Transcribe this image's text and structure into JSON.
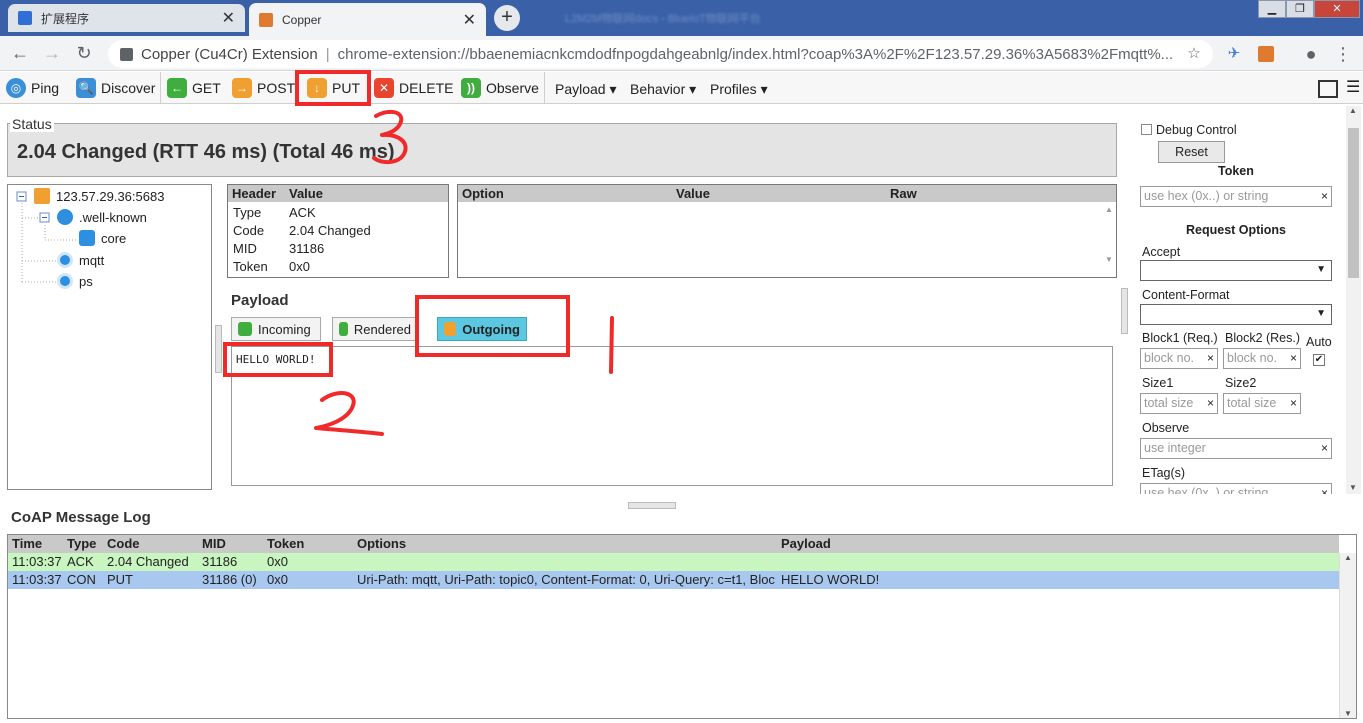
{
  "browser": {
    "tabs": [
      {
        "label": "扩展程序",
        "icon": "puzzle-icon"
      },
      {
        "label": "Copper",
        "icon": "copper-logo-icon"
      }
    ],
    "blurred_title": "L2M2M物联网docs - BlueIoT物联网平台",
    "omnibox": {
      "title": "Copper (Cu4Cr) Extension",
      "separator": "|",
      "url": "chrome-extension://bbaenemiacnkcmdodfnpogdahgeabnlg/index.html?coap%3A%2F%2F123.57.29.36%3A5683%2Fmqtt%..."
    }
  },
  "toolbar": {
    "buttons": [
      {
        "label": "Ping",
        "icon": "ping-icon",
        "color": "#3a8fd8"
      },
      {
        "label": "Discover",
        "icon": "discover-icon",
        "color": "#3a8fd8"
      },
      {
        "label": "GET",
        "icon": "get-icon",
        "color": "#3fae3f"
      },
      {
        "label": "POST",
        "icon": "post-icon",
        "color": "#f0a030"
      },
      {
        "label": "PUT",
        "icon": "put-icon",
        "color": "#f0a030"
      },
      {
        "label": "DELETE",
        "icon": "delete-icon",
        "color": "#e8442e"
      },
      {
        "label": "Observe",
        "icon": "observe-icon",
        "color": "#3fae3f"
      }
    ],
    "menus": [
      "Payload ▾",
      "Behavior ▾",
      "Profiles ▾"
    ]
  },
  "status": {
    "legend": "Status",
    "text": "2.04 Changed (RTT 46 ms) (Total 46 ms)"
  },
  "tree": {
    "root": "123.57.29.36:5683",
    "nodes": [
      ".well-known",
      "core",
      "mqtt",
      "ps"
    ]
  },
  "header_table": {
    "columns": [
      "Header",
      "Value"
    ],
    "rows": [
      {
        "key": "Type",
        "value": "ACK"
      },
      {
        "key": "Code",
        "value": "2.04 Changed"
      },
      {
        "key": "MID",
        "value": "31186"
      },
      {
        "key": "Token",
        "value": "0x0"
      }
    ]
  },
  "options_table": {
    "columns": [
      "Option",
      "Value",
      "Raw"
    ]
  },
  "payload": {
    "title": "Payload",
    "tabs": [
      "Incoming",
      "Rendered",
      "Outgoing"
    ],
    "active_tab": "Outgoing",
    "content": "HELLO WORLD!"
  },
  "right_panel": {
    "debug_control": "Debug Control",
    "reset": "Reset",
    "token_heading": "Token",
    "token_placeholder": "use hex (0x..) or string",
    "request_options": "Request Options",
    "accept": "Accept",
    "content_format": "Content-Format",
    "block1": "Block1 (Req.)",
    "block2": "Block2 (Res.)",
    "auto": "Auto",
    "block_placeholder": "block no.",
    "size1": "Size1",
    "size2": "Size2",
    "size_placeholder": "total size",
    "observe": "Observe",
    "observe_placeholder": "use integer",
    "etag": "ETag(s)",
    "etag_placeholder": "use hex (0x..) or string"
  },
  "log": {
    "title": "CoAP Message Log",
    "columns": [
      "Time",
      "Type",
      "Code",
      "MID",
      "Token",
      "Options",
      "Payload"
    ],
    "rows": [
      {
        "time": "11:03:37",
        "type": "ACK",
        "code": "2.04 Changed",
        "mid": "31186",
        "token": "0x0",
        "options": "",
        "payload": "",
        "color": "#c8f5c0"
      },
      {
        "time": "11:03:37",
        "type": "CON",
        "code": "PUT",
        "mid": "31186 (0)",
        "token": "0x0",
        "options": "Uri-Path: mqtt, Uri-Path: topic0, Content-Format: 0, Uri-Query: c=t1, Bloc",
        "payload": "HELLO WORLD!",
        "color": "#a9c8f0"
      }
    ]
  },
  "annotations": [
    "1",
    "2",
    "3"
  ]
}
